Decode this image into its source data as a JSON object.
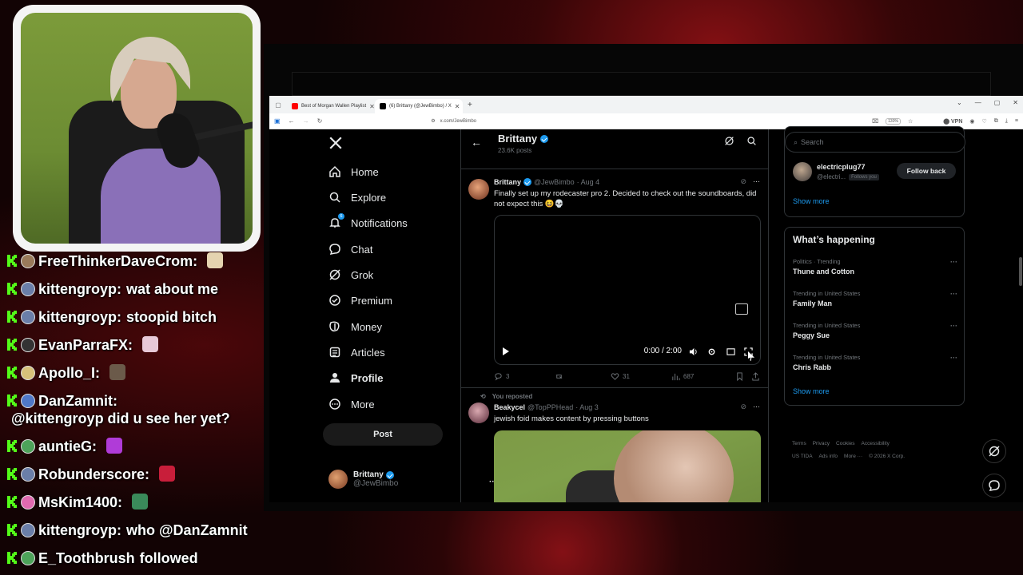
{
  "chat": {
    "messages": [
      {
        "user": "FreeThinkerDaveCrom:",
        "text": "",
        "emote_color": "#e5d4b0",
        "avatar_color": "#9a7a5a"
      },
      {
        "user": "kittengroyp:",
        "text": "wat about me",
        "emote_color": "",
        "avatar_color": "#6a7ea8"
      },
      {
        "user": "kittengroyp:",
        "text": "stoopid bitch",
        "emote_color": "",
        "avatar_color": "#6a7ea8"
      },
      {
        "user": "EvanParraFX:",
        "text": "",
        "emote_color": "#e8c9d8",
        "avatar_color": "#333333"
      },
      {
        "user": "Apollo_I:",
        "text": "",
        "emote_color": "#6b5a4a",
        "avatar_color": "#d6c27a"
      },
      {
        "user": "DanZamnit:",
        "text": "@kittengroyp did u see her yet?",
        "emote_color": "",
        "avatar_color": "#4f78c8"
      },
      {
        "user": "auntieG:",
        "text": "",
        "emote_color": "#b03bd8",
        "avatar_color": "#4da35a"
      },
      {
        "user": "Robunderscore:",
        "text": "",
        "emote_color": "#c81e3a",
        "avatar_color": "#6a7ea8"
      },
      {
        "user": "MsKim1400:",
        "text": "",
        "emote_color": "#3a8a5a",
        "avatar_color": "#e06ab0"
      },
      {
        "user": "kittengroyp:",
        "text": "who @DanZamnit",
        "emote_color": "",
        "avatar_color": "#6a7ea8"
      },
      {
        "user": "E_Toothbrush",
        "text": "followed",
        "emote_color": "",
        "avatar_color": "#4da35a"
      }
    ]
  },
  "browser": {
    "tabs": [
      {
        "label": "Best of Morgan Wallen Playlist",
        "favicon_color": "#ff0000"
      },
      {
        "label": "(6) Brittany (@JewBimbo) / X",
        "favicon_color": "#000000"
      }
    ],
    "url": "x.com/JewBimbo",
    "zoom": "130%",
    "vpn": "VPN"
  },
  "x": {
    "nav": [
      {
        "label": "Home",
        "icon": "home-icon"
      },
      {
        "label": "Explore",
        "icon": "search-icon"
      },
      {
        "label": "Notifications",
        "icon": "bell-icon",
        "badge": "6"
      },
      {
        "label": "Chat",
        "icon": "chat-icon"
      },
      {
        "label": "Grok",
        "icon": "grok-icon"
      },
      {
        "label": "Premium",
        "icon": "premium-icon"
      },
      {
        "label": "Money",
        "icon": "money-icon"
      },
      {
        "label": "Articles",
        "icon": "articles-icon"
      },
      {
        "label": "Profile",
        "icon": "profile-icon"
      },
      {
        "label": "More",
        "icon": "more-icon"
      }
    ],
    "post_button": "Post",
    "account": {
      "name": "Brittany",
      "handle": "@JewBimbo"
    },
    "profile_header": {
      "name": "Brittany",
      "posts": "23.6K posts"
    },
    "tweets": [
      {
        "name": "Brittany",
        "handle": "@JewBimbo",
        "date": "· Aug 4",
        "text": "Finally set up my rodecaster pro 2. Decided to check out the soundboards, did not expect this 😆💀",
        "video_time": "0:00 / 2:00",
        "replies": "3",
        "likes": "31",
        "views": "687"
      },
      {
        "reposted_label": "You reposted",
        "name": "Beakycel",
        "handle": "@TopPPHead",
        "date": "· Aug 3",
        "text": "jewish foid makes content by pressing buttons"
      }
    ],
    "right": {
      "search_placeholder": "Search",
      "who_to_follow": {
        "name": "electricplug77",
        "handle": "@electri...",
        "follows_you": "Follows you",
        "button": "Follow back"
      },
      "show_more": "Show more",
      "whats_happening": "What’s happening",
      "trends": [
        {
          "category": "Politics · Trending",
          "title": "Thune and Cotton"
        },
        {
          "category": "Trending in United States",
          "title": "Family Man"
        },
        {
          "category": "Trending in United States",
          "title": "Peggy Sue"
        },
        {
          "category": "Trending in United States",
          "title": "Chris Rabb"
        }
      ],
      "footer": [
        "Terms",
        "Privacy",
        "Cookies",
        "Accessibility",
        "US TIDA",
        "Ads info",
        "More ···",
        "© 2026 X Corp."
      ]
    }
  },
  "colors": {
    "accent": "#1d9bf0",
    "kick_green": "#53fc18",
    "bg": "#000000"
  }
}
